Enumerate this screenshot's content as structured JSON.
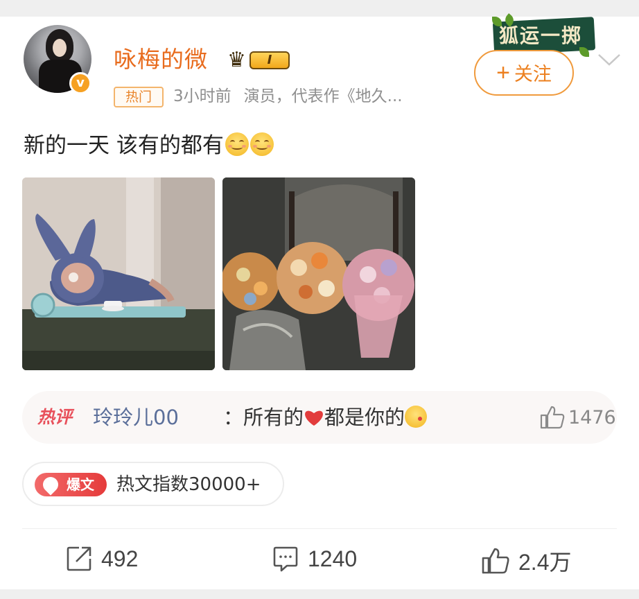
{
  "post": {
    "author": {
      "name": "咏梅的微",
      "level_badge": "I",
      "verified_mark": "v"
    },
    "tag": "热门",
    "time": "3小时前",
    "source": "演员，代表作《地久...",
    "follow_label": "关注",
    "follow_plus": "+",
    "sticker_text": "狐运一掷",
    "text": "新的一天 该有的都有",
    "text_emojis": [
      "smile-emoji",
      "smile-emoji"
    ],
    "images": [
      {
        "name": "labubu-toy-photo"
      },
      {
        "name": "flower-bouquets-photo"
      }
    ]
  },
  "hot_comment": {
    "tag": "热评",
    "user": "玲玲儿00",
    "separator": "：",
    "text_before": "所有的",
    "text_after": "都是你的",
    "likes": "1476"
  },
  "baowen": {
    "badge": "爆文",
    "text": "热文指数30000+"
  },
  "actions": {
    "reposts": "492",
    "comments": "1240",
    "likes": "2.4万"
  },
  "colors": {
    "username": "#e86c1e",
    "accent_orange": "#ec7f1e",
    "comment_user": "#5b6f9a",
    "hot_red": "#e8505b"
  }
}
